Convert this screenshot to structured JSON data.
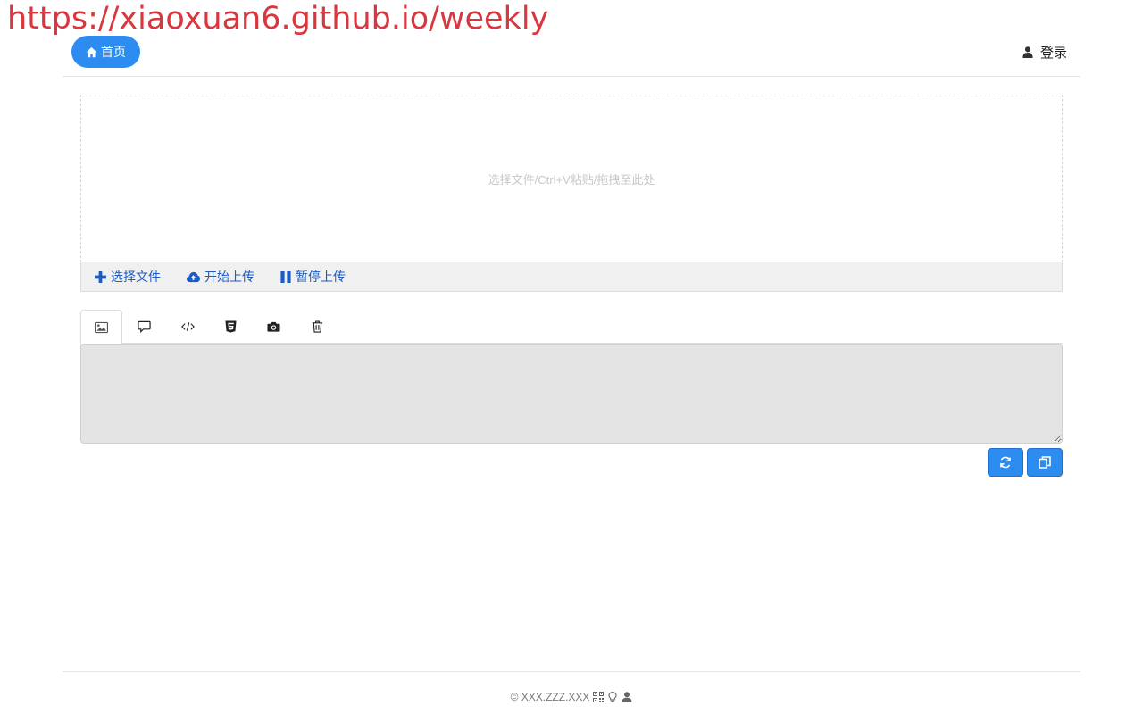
{
  "watermark": {
    "text": "https://xiaoxuan6.github.io/weekly"
  },
  "nav": {
    "home_label": "首页",
    "home_icon": "home-icon",
    "login_label": "登录",
    "login_icon": "user-icon",
    "accent_color": "#2d8cf0"
  },
  "dropzone": {
    "hint": "选择文件/Ctrl+V粘贴/拖拽至此处"
  },
  "upload_toolbar": {
    "choose_label": "选择文件",
    "start_label": "开始上传",
    "pause_label": "暂停上传",
    "icons": [
      "plus-icon",
      "cloud-upload-icon",
      "pause-icon"
    ]
  },
  "tabs": [
    {
      "icon": "image-icon",
      "active": true
    },
    {
      "icon": "comment-icon",
      "active": false
    },
    {
      "icon": "code-icon",
      "active": false
    },
    {
      "icon": "html5-icon",
      "active": false
    },
    {
      "icon": "camera-icon",
      "active": false
    },
    {
      "icon": "trash-icon",
      "active": false
    }
  ],
  "result": {
    "value": ""
  },
  "actions": [
    "refresh-icon",
    "copy-icon"
  ],
  "footer": {
    "copyright": "© XXX.ZZZ.XXX",
    "icons": [
      "qrcode-icon",
      "lightbulb-icon",
      "user-icon"
    ]
  }
}
